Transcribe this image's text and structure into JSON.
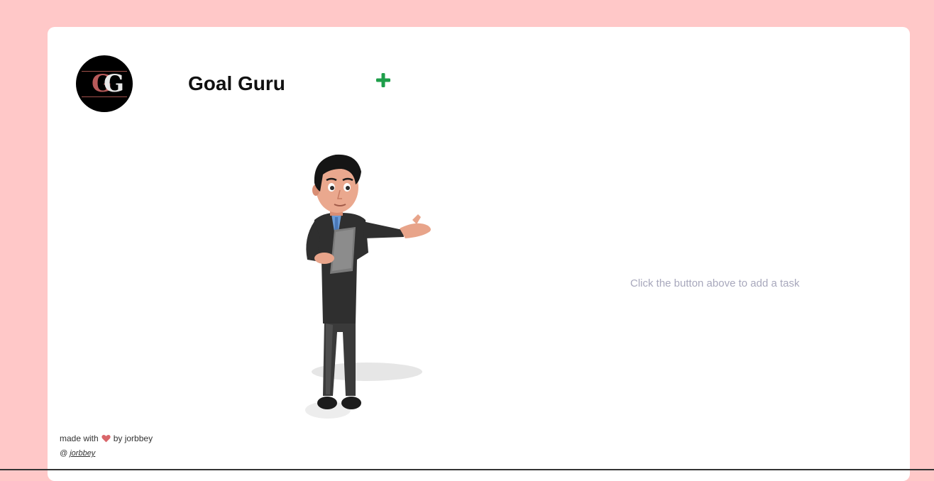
{
  "header": {
    "logo_monogram_left": "G",
    "logo_monogram_right": "G",
    "title": "Goal Guru"
  },
  "colors": {
    "page_background": "#ffc8c8",
    "card_background": "#ffffff",
    "add_button": "#1e9e4a",
    "heart": "#d9666a",
    "empty_text": "#a8a8bc"
  },
  "icons": {
    "add": "plus-icon",
    "heart": "heart-icon"
  },
  "tasks": {
    "items": [],
    "empty_message": "Click the button above to add a task"
  },
  "footer": {
    "made_with_prefix": "made with",
    "made_with_suffix": "by jorbbey",
    "handle_prefix": "@",
    "handle_link": "jorbbey"
  }
}
